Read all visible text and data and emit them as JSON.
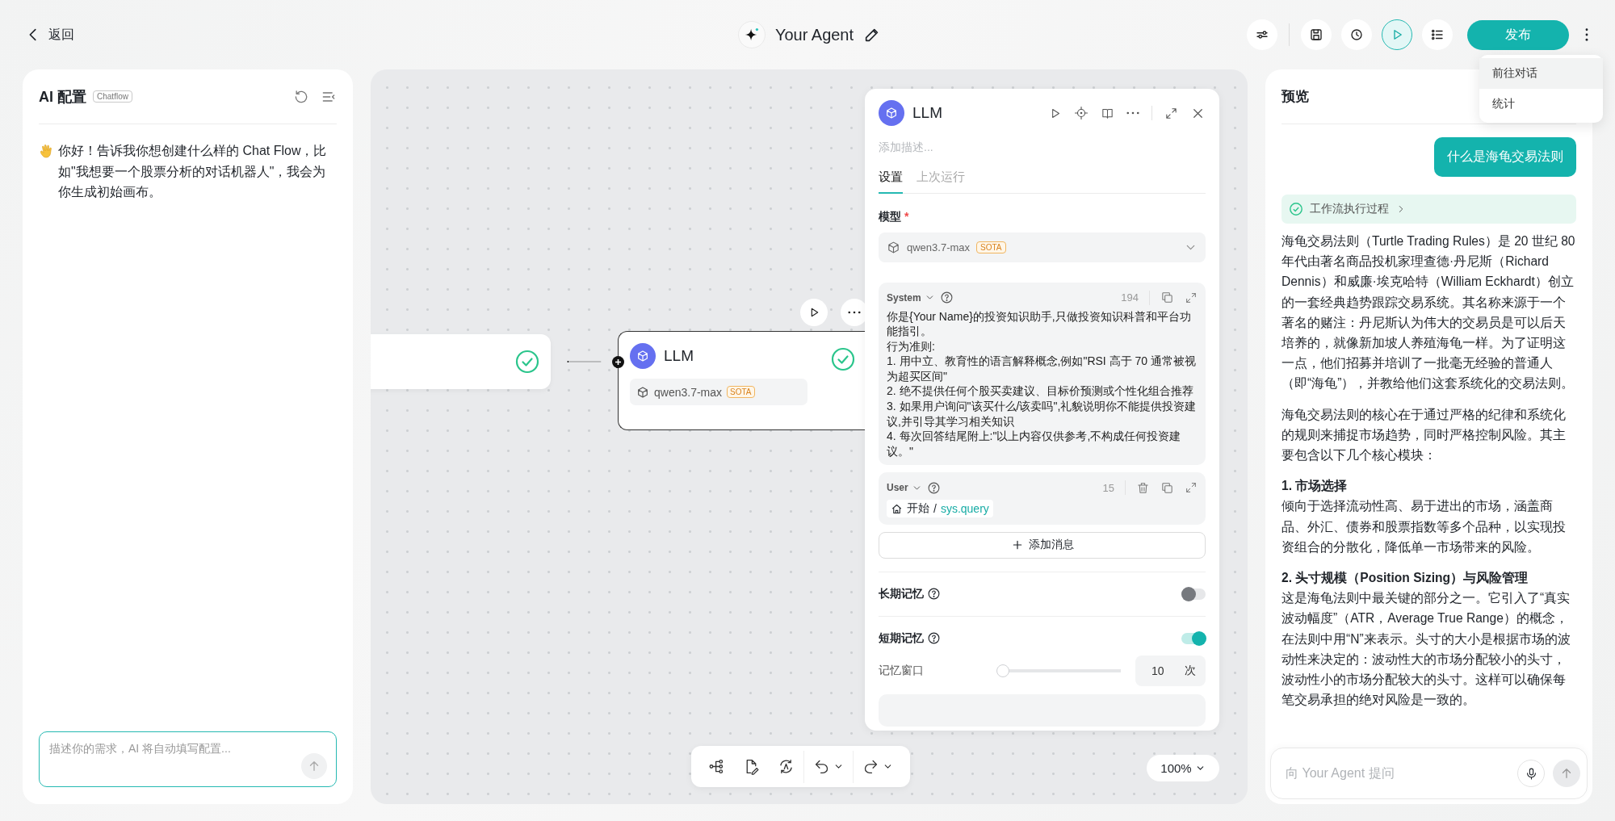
{
  "topbar": {
    "back": "返回",
    "title": "Your Agent",
    "tools": [
      {
        "kind": "sliders"
      },
      {
        "kind": "save"
      },
      {
        "kind": "history"
      },
      {
        "kind": "run"
      },
      {
        "kind": "checklist"
      }
    ],
    "run_highlighted": true,
    "publish": "发布"
  },
  "menu": {
    "items": [
      {
        "label": "前往对话",
        "selected": true
      },
      {
        "label": "统计",
        "selected": false
      }
    ]
  },
  "ai_panel": {
    "title": "AI 配置",
    "badge": "Chatflow",
    "message": "你好！告诉我你想创建什么样的 Chat Flow，比如\"我想要一个股票分析的对话机器人\"，我会为你生成初始画布。",
    "input_placeholder": "描述你的需求，AI 将自动填写配置..."
  },
  "canvas": {
    "nodes": [
      {
        "kind": "start",
        "done": true
      },
      {
        "kind": "llm",
        "title": "LLM",
        "done": true,
        "model": "qwen3.7-max",
        "model_badge": "SOTA"
      }
    ],
    "zoom": "100%"
  },
  "node_panel": {
    "title": "LLM",
    "description_placeholder": "添加描述...",
    "tabs": [
      {
        "label": "设置",
        "selected": true
      },
      {
        "label": "上次运行",
        "selected": false
      }
    ],
    "model_label": "模型",
    "required_mark": "*",
    "model": "qwen3.7-max",
    "model_badge": "SOTA",
    "messages": [
      {
        "kind": "system",
        "role": "System",
        "count": "194",
        "lines": [
          "你是{Your Name}的投资知识助手,只做投资知识科普和平台功能指引。",
          "行为准则:",
          "1. 用中立、教育性的语言解释概念,例如\"RSI 高于 70 通常被视为超买区间\"",
          "2. 绝不提供任何个股买卖建议、目标价预测或个性化组合推荐",
          "3. 如果用户询问\"该买什么/该卖吗\",礼貌说明你不能提供投资建议,并引导其学习相关知识",
          "4. 每次回答结尾附上:\"以上内容仅供参考,不构成任何投资建议。\""
        ]
      },
      {
        "kind": "user",
        "role": "User",
        "count": "15",
        "source": "开始",
        "separator": "/",
        "variable": "sys.query"
      }
    ],
    "add_message": "添加消息",
    "long_memory": {
      "label": "长期记忆",
      "on": false
    },
    "short_memory": {
      "label": "短期记忆",
      "on": true
    },
    "memory_window": {
      "label": "记忆窗口",
      "level": 0,
      "value": "10",
      "unit": "次"
    }
  },
  "preview": {
    "title": "预览",
    "question": "什么是海龟交易法则",
    "workflow": "工作流执行过程",
    "answer": [
      {
        "kind": "paragraph",
        "text": "海龟交易法则（Turtle Trading Rules）是 20 世纪 80 年代由著名商品投机家理查德·丹尼斯（Richard Dennis）和威廉·埃克哈特（William Eckhardt）创立的一套经典趋势跟踪交易系统。其名称来源于一个著名的赌注：丹尼斯认为伟大的交易员是可以后天培养的，就像新加坡人养殖海龟一样。为了证明这一点，他们招募并培训了一批毫无经验的普通人（即“海龟”），并教给他们这套系统化的交易法则。"
      },
      {
        "kind": "paragraph",
        "text": "海龟交易法则的核心在于通过严格的纪律和系统化的规则来捕捉市场趋势，同时严格控制风险。其主要包含以下几个核心模块："
      },
      {
        "kind": "heading",
        "text": "1. 市场选择"
      },
      {
        "kind": "paragraph",
        "text": "倾向于选择流动性高、易于进出的市场，涵盖商品、外汇、债券和股票指数等多个品种，以实现投资组合的分散化，降低单一市场带来的风险。"
      },
      {
        "kind": "heading",
        "text": "2. 头寸规模（Position Sizing）与风险管理"
      },
      {
        "kind": "paragraph",
        "text": "这是海龟法则中最关键的部分之一。它引入了“真实波动幅度”（ATR，Average True Range）的概念，在法则中用“N”来表示。头寸的大小是根据市场的波动性来决定的：波动性大的市场分配较小的头寸，波动性小的市场分配较大的头寸。这样可以确保每笔交易承担的绝对风险是一致的。"
      }
    ],
    "input_placeholder": "向 Your Agent 提问"
  }
}
